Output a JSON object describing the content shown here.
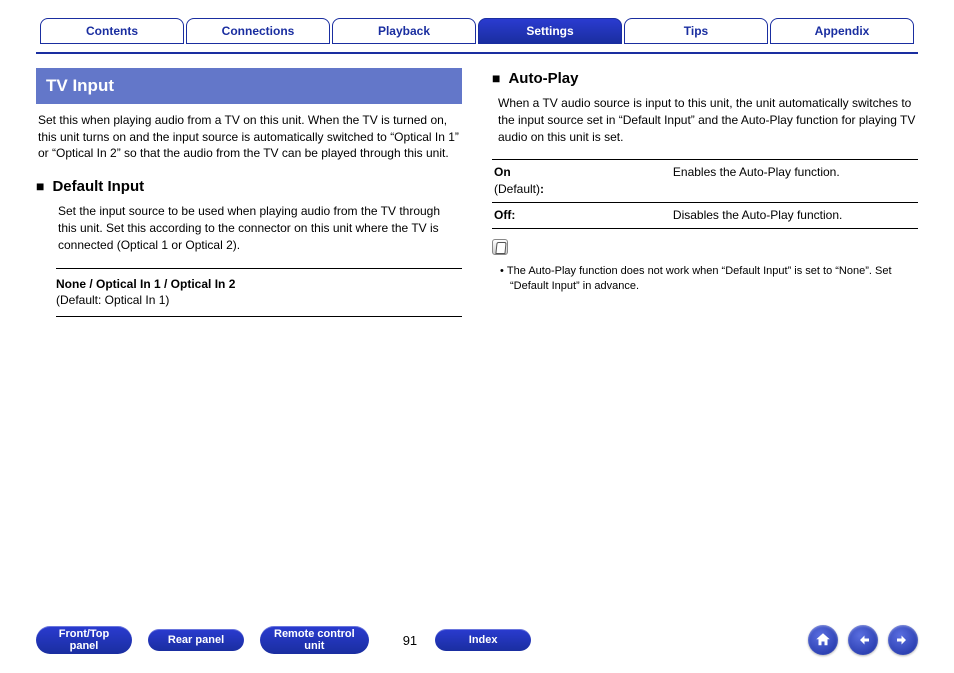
{
  "topnav": {
    "tabs": [
      "Contents",
      "Connections",
      "Playback",
      "Settings",
      "Tips",
      "Appendix"
    ],
    "active_index": 3
  },
  "left": {
    "title": "TV Input",
    "intro": "Set this when playing audio from a TV on this unit. When the TV is turned on, this unit turns on and the input source is automatically switched to “Optical In 1” or “Optical In 2” so that the audio from the TV can be played through this unit.",
    "section": {
      "heading": "Default Input",
      "desc": "Set the input source to be used when playing audio from the TV through this unit. Set this according to the connector on this unit where the TV is connected (Optical 1 or Optical 2).",
      "options_label": "None / Optical In 1 / Optical In 2",
      "default_label": "(Default: Optical In 1)"
    }
  },
  "right": {
    "heading": "Auto-Play",
    "desc": "When a TV audio source is input to this unit, the unit automatically switches to the input source set in “Default Input” and the Auto-Play function for playing TV audio on this unit is set.",
    "rows": [
      {
        "key_bold": "On",
        "key_sub": "(Default)",
        "key_tail": ":",
        "val": "Enables the Auto-Play function."
      },
      {
        "key_bold": "Off:",
        "key_sub": "",
        "key_tail": "",
        "val": "Disables the Auto-Play function."
      }
    ],
    "note": "The Auto-Play function does not work when “Default Input” is set to “None”. Set “Default Input” in advance."
  },
  "bottom": {
    "buttons": [
      "Front/Top panel",
      "Rear panel",
      "Remote control unit"
    ],
    "page": "91",
    "index_label": "Index"
  }
}
